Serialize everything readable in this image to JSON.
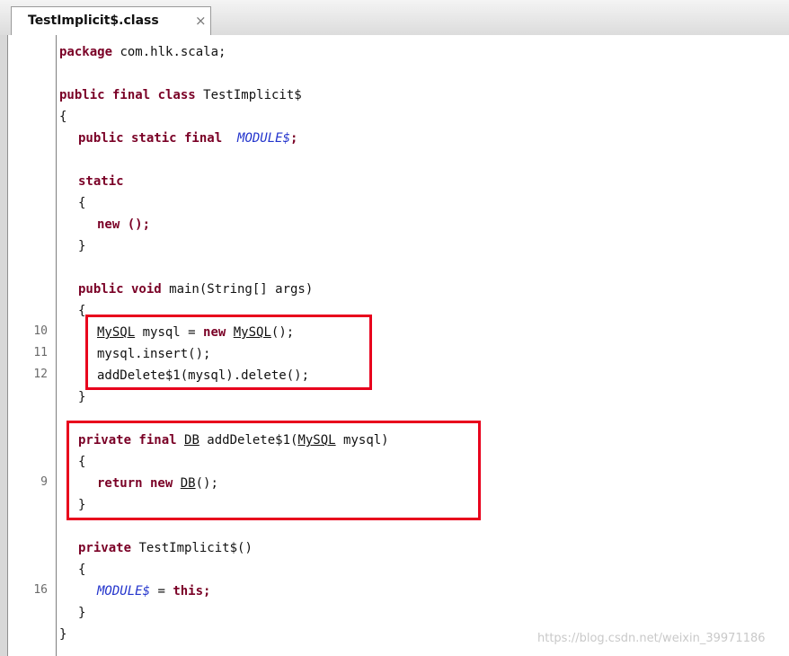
{
  "tab": {
    "title": "TestImplicit$.class",
    "close": "×"
  },
  "line_numbers": {
    "n10": "10",
    "n11": "11",
    "n12": "12",
    "n9": "9",
    "n16": "16"
  },
  "code": {
    "package": "package",
    "package_name": " com.hlk.scala;",
    "class_kw": "public final class",
    "class_name": " TestImplicit$",
    "brace_open": "{",
    "brace_close": "}",
    "module_kw": "public static final",
    "module_field": "MODULE$",
    "semicolon": ";",
    "static_kw": "static",
    "new_kw": "new",
    "new_call": " ();",
    "main_kw": "public void",
    "main_sig": " main(String[] args)",
    "mysql_type": "MySQL",
    "mysql_decl": " mysql = ",
    "mysql_ctor": "MySQL",
    "mysql_tail": "();",
    "insert_call": "mysql.insert();",
    "delete_call": "addDelete$1(mysql).delete();",
    "private_final_kw": "private final",
    "db_type": "DB",
    "adddelete_sig": " addDelete$1(",
    "adddelete_param_type": "MySQL",
    "adddelete_param": " mysql)",
    "return_kw": "return new",
    "db_ctor": "DB",
    "db_tail": "();",
    "private_kw": "private",
    "ctor_name": " TestImplicit$()",
    "module_assign": " = ",
    "this_kw": "this;"
  },
  "watermark": "https://blog.csdn.net/weixin_39971186",
  "colors": {
    "keyword": "#7a0026",
    "static_field": "#2233cc",
    "highlight": "#e8001c"
  }
}
